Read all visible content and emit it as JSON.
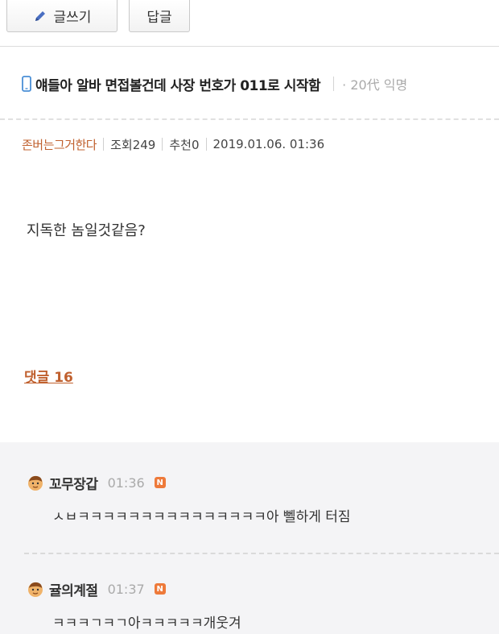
{
  "toolbar": {
    "write_label": "글쓰기",
    "reply_label": "답글",
    "pencil_icon": "pencil-icon"
  },
  "post": {
    "title": "얘들아 알바 면접볼건데 사장 번호가 011로 시작함",
    "board": "· 20代 익명",
    "author": "존버는그거한다",
    "views": "조회249",
    "recommend": "추천0",
    "datetime": "2019.01.06. 01:36",
    "body": "지독한 놈일것같음?",
    "device_icon": "mobile-phone-icon"
  },
  "comments_section": {
    "link_label": "댓글 16",
    "items": [
      {
        "name": "꼬무장갑",
        "time": "01:36",
        "badge": "N",
        "text": "ㅅㅂㅋㅋㅋㅋㅋㅋㅋㅋㅋㅋㅋㅋㅋㅋㅋ아 뻴하게 터짐"
      },
      {
        "name": "귤의계절",
        "time": "01:37",
        "badge": "N",
        "text": "ㅋㅋㅋㄱㅋㄱ아ㅋㅋㅋㅋㅋ개웃겨"
      }
    ]
  },
  "colors": {
    "accent": "#c0602e",
    "badge": "#ee7a3a",
    "comment_bg": "#f4f4f6",
    "phone_icon": "#4a8fd6"
  }
}
